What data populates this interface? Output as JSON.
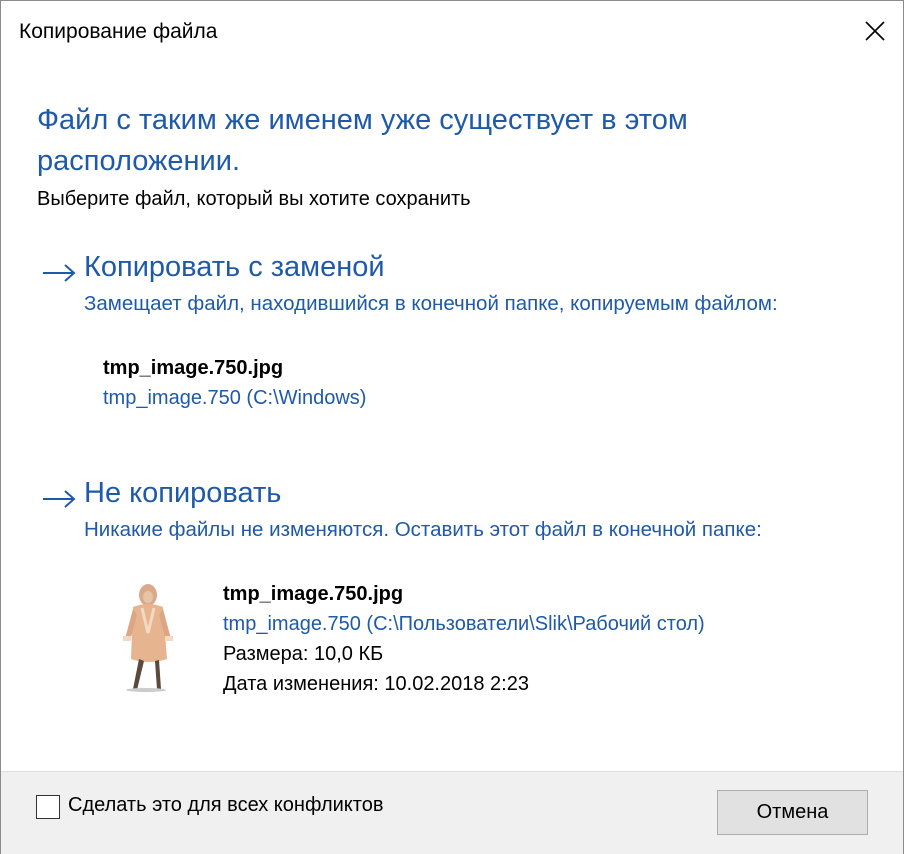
{
  "window": {
    "title": "Копирование файла"
  },
  "heading": "Файл с таким же именем уже существует в этом расположении.",
  "subheading": "Выберите файл, который вы хотите сохранить",
  "options": [
    {
      "title": "Копировать с заменой",
      "description": "Замещает файл, находившийся в конечной папке, копируемым файлом:",
      "file": {
        "name": "tmp_image.750.jpg",
        "path": "tmp_image.750 (C:\\Windows)"
      }
    },
    {
      "title": "Не копировать",
      "description": "Никакие файлы не изменяются. Оставить этот файл в конечной папке:",
      "file": {
        "name": "tmp_image.750.jpg",
        "path": "tmp_image.750 (C:\\Пользователи\\Slik\\Рабочий стол)",
        "size": "Размера: 10,0 КБ",
        "modified": "Дата изменения: 10.02.2018 2:23"
      }
    }
  ],
  "footer": {
    "checkbox_label": "Сделать это для всех конфликтов",
    "checkbox_checked": false,
    "cancel_label": "Отмена"
  },
  "colors": {
    "accent": "#1e5aa8",
    "footer_bg": "#f0f0f0",
    "button_bg": "#e1e1e1"
  }
}
